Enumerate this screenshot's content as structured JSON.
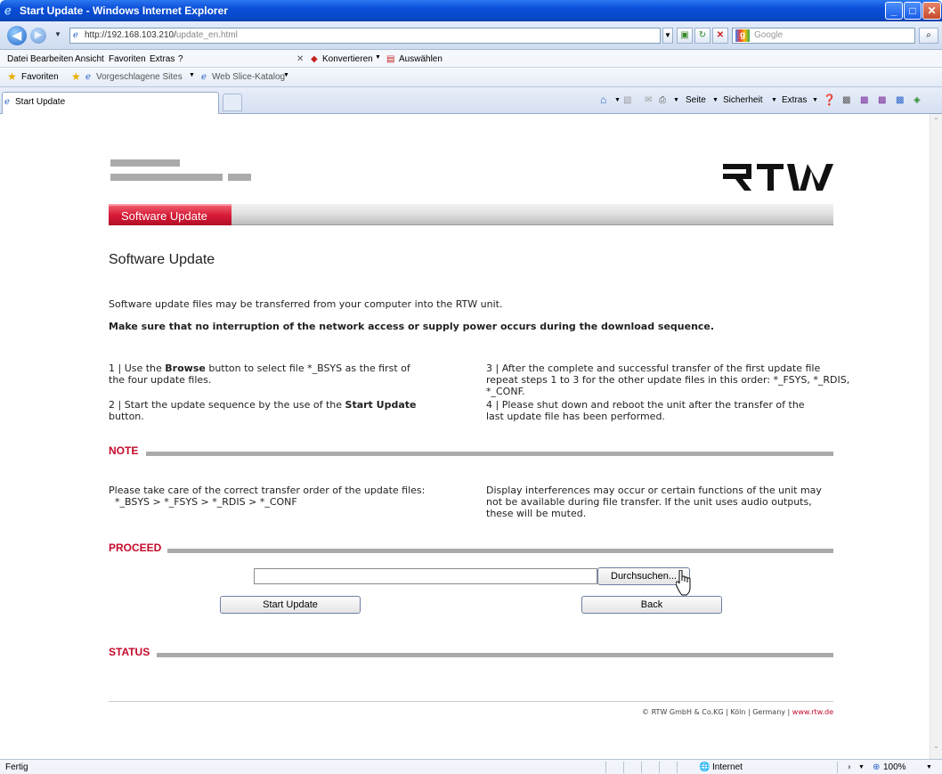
{
  "window": {
    "title": "Start Update - Windows Internet Explorer"
  },
  "address": {
    "url_host": "http://192.168.103.210/",
    "url_path": "update_en.html",
    "search_placeholder": "Google"
  },
  "menu": [
    "Datei",
    "Bearbeiten",
    "Ansicht",
    "Favoriten",
    "Extras",
    "?"
  ],
  "menu_tools": {
    "convert": "Konvertieren",
    "select": "Auswählen"
  },
  "favorites": {
    "label": "Favoriten",
    "suggested": "Vorgeschlagene Sites",
    "webslice": "Web Slice-Katalog"
  },
  "tab": {
    "title": "Start Update"
  },
  "commandbar": {
    "page": "Seite",
    "security": "Sicherheit",
    "extras": "Extras"
  },
  "page": {
    "nav_tab": "Software Update",
    "title": "Software Update",
    "intro": "Software update files may be transferred from your computer into the RTW unit.",
    "warning": "Make sure that no interruption of the network access or supply power occurs during the download sequence.",
    "step1_pre": "1 | Use the ",
    "step1_bold": "Browse",
    "step1_post": " button to select file *_BSYS as the first of the four update files.",
    "step2_pre": "2 | Start the update sequence by the use of the ",
    "step2_bold": "Start Update",
    "step2_post": " button.",
    "step3": "3 | After the complete and successful transfer of the first update file repeat steps 1 to 3 for the other update files in this order: *_FSYS, *_RDIS, *_CONF.",
    "step4": "4 | Please shut down and reboot the unit after the transfer of the last update file has been performed.",
    "note_heading": "NOTE",
    "note_left_1": "Please take care of the correct transfer order of the update files:",
    "note_left_2": "*_BSYS > *_FSYS > *_RDIS > *_CONF",
    "note_right": "Display interferences may occur or certain functions of the unit may not be available during file transfer. If the unit uses audio outputs, these will be muted.",
    "proceed_heading": "PROCEED",
    "file_value": "",
    "browse_label": "Durchsuchen...",
    "start_label": "Start Update",
    "back_label": "Back",
    "status_heading": "STATUS",
    "footer_text": "© RTW GmbH & Co.KG | Köln | Germany | ",
    "footer_link": "www.rtw.de"
  },
  "status": {
    "left": "Fertig",
    "zone": "Internet",
    "zoom": "100%"
  },
  "colors": {
    "accent_red": "#c40b2b",
    "title_blue": "#0a4ed8"
  },
  "icons": [
    "ie-icon",
    "back-icon",
    "forward-icon",
    "page-icon",
    "refresh-icon",
    "stop-icon",
    "search-icon",
    "star-icon",
    "home-icon",
    "feed-icon",
    "mail-icon",
    "print-icon",
    "help-icon",
    "globe-icon",
    "cursor-icon"
  ]
}
